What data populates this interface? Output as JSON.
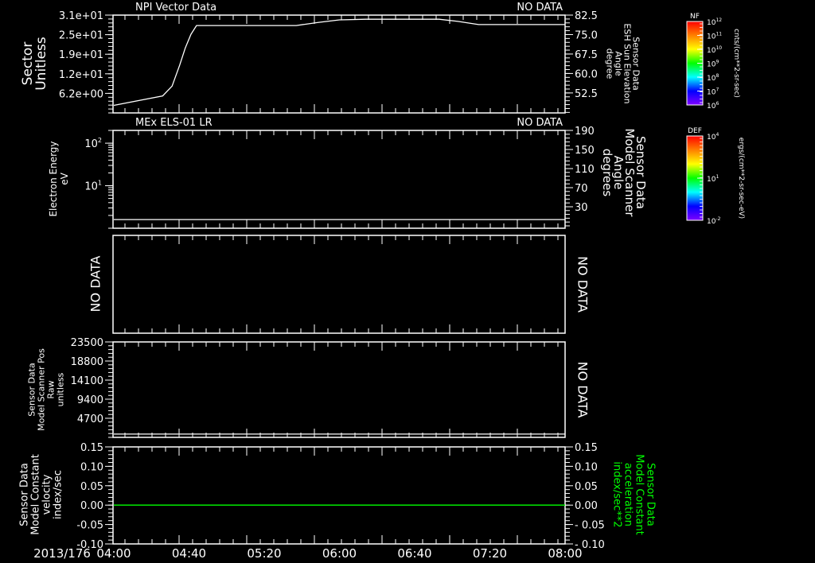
{
  "date_label": "2013/176",
  "x_ticks": [
    "04:00",
    "04:40",
    "05:20",
    "06:00",
    "06:40",
    "07:20",
    "08:00"
  ],
  "colors": {
    "background": "#000000",
    "axis": "#ffffff",
    "accent": "#00ff00"
  },
  "chart_data": [
    {
      "type": "line",
      "title": "NPI Vector Data",
      "status": "NO DATA",
      "ylabel": [
        "Sector",
        "Unitless"
      ],
      "yscale": "linear",
      "ylim": [
        0,
        31
      ],
      "yticks": [
        {
          "value": 31,
          "label": "3.1e+01"
        },
        {
          "value": 24.8,
          "label": "2.5e+01"
        },
        {
          "value": 18.6,
          "label": "1.9e+01"
        },
        {
          "value": 12.4,
          "label": "1.2e+01"
        },
        {
          "value": 6.2,
          "label": "6.2e+00"
        }
      ],
      "y2label": [
        "Sensor Data",
        "ESH Sun Elevation",
        "Angle",
        "degree"
      ],
      "y2lim": [
        44.8,
        82.5
      ],
      "y2ticks": [
        {
          "value": 82.5,
          "label": "82.5"
        },
        {
          "value": 75,
          "label": "75.0"
        },
        {
          "value": 67.5,
          "label": "67.5"
        },
        {
          "value": 60,
          "label": "60.0"
        },
        {
          "value": 52.5,
          "label": "52.5"
        }
      ],
      "series": [
        {
          "color": "#ffffff",
          "x": [
            "04:00",
            "04:26",
            "04:31",
            "04:35",
            "04:38",
            "04:41",
            "04:44",
            "05:37",
            "05:49",
            "06:00",
            "06:14",
            "06:53",
            "07:03",
            "07:14",
            "08:00"
          ],
          "y": [
            2.4,
            5.4,
            8.5,
            15.1,
            20.6,
            24.9,
            27.7,
            27.7,
            28.7,
            29.5,
            29.7,
            29.7,
            29.0,
            28.0,
            28.0
          ]
        }
      ]
    },
    {
      "type": "line",
      "title": "MEx ELS-01 LR",
      "status": "NO DATA",
      "ylabel": [
        "Electron Energy",
        "eV"
      ],
      "yscale": "log",
      "ylim": [
        1,
        200
      ],
      "yticks": [
        {
          "value": 100,
          "base": "10",
          "exp": "2"
        },
        {
          "value": 10,
          "base": "10",
          "exp": "1"
        }
      ],
      "y2label": [
        "Sensor Data",
        "Model Scanner",
        "Angle",
        "degrees"
      ],
      "y2lim": [
        -15,
        190
      ],
      "y2ticks": [
        {
          "value": 190,
          "label": "190"
        },
        {
          "value": 150,
          "label": "150"
        },
        {
          "value": 110,
          "label": "110"
        },
        {
          "value": 70,
          "label": "70"
        },
        {
          "value": 30,
          "label": "30"
        }
      ],
      "series": [
        {
          "color": "#ffffff",
          "x": [
            "04:00",
            "08:00"
          ],
          "y": [
            1.6,
            1.6
          ]
        }
      ]
    },
    {
      "type": "line",
      "no_data_left": "NO DATA",
      "no_data_right": "NO DATA"
    },
    {
      "type": "line",
      "ylabel": [
        "Sensor Data",
        "Model Scanner Pos",
        "Raw",
        "unitless"
      ],
      "yscale": "linear",
      "ylim": [
        0,
        23500
      ],
      "yticks": [
        {
          "value": 23500,
          "label": "23500"
        },
        {
          "value": 18800,
          "label": "18800"
        },
        {
          "value": 14100,
          "label": "14100"
        },
        {
          "value": 9400,
          "label": "9400"
        },
        {
          "value": 4700,
          "label": "4700"
        }
      ],
      "no_data_right": "NO DATA",
      "series": [
        {
          "color": "#ffffff",
          "x": [
            "04:00",
            "08:00"
          ],
          "y": [
            800,
            800
          ]
        }
      ]
    },
    {
      "type": "line",
      "ylabel": [
        "Sensor Data",
        "Model Constant",
        "velocity",
        "index/sec"
      ],
      "yscale": "linear",
      "ylim": [
        -0.1,
        0.15
      ],
      "yticks": [
        {
          "value": 0.15,
          "label": "0.15"
        },
        {
          "value": 0.1,
          "label": "0.10"
        },
        {
          "value": 0.05,
          "label": "0.05"
        },
        {
          "value": 0,
          "label": "0.00"
        },
        {
          "value": -0.05,
          "label": "-0.05"
        },
        {
          "value": -0.1,
          "label": "-0.10"
        }
      ],
      "y2label": [
        "Sensor Data",
        "Model Constant",
        "acceleration",
        "index/sec**2"
      ],
      "y2label_color": "#00ff00",
      "y2lim": [
        -0.1,
        0.15
      ],
      "y2ticks": [
        {
          "value": 0.15,
          "label": "0.15"
        },
        {
          "value": 0.1,
          "label": "0.10"
        },
        {
          "value": 0.05,
          "label": "0.05"
        },
        {
          "value": 0,
          "label": "0.00"
        },
        {
          "value": -0.05,
          "label": "- 0.05"
        },
        {
          "value": -0.1,
          "label": "- 0.10"
        }
      ],
      "series": [
        {
          "color": "#00ff00",
          "x": [
            "04:00",
            "08:00"
          ],
          "y": [
            0,
            0
          ]
        }
      ]
    }
  ],
  "colorbars": [
    {
      "label": "NF",
      "base": "10",
      "exps": [
        "12",
        "11",
        "10",
        "9",
        "8",
        "7",
        "6"
      ],
      "unit": "cnts/(cm**2-sr-sec)",
      "colors": [
        "#ff0000",
        "#ff8000",
        "#ffff00",
        "#00ff00",
        "#00ffff",
        "#0000ff",
        "#8000ff"
      ]
    },
    {
      "label": "DEF",
      "base": "10",
      "exps": [
        "4",
        "1",
        "-2"
      ],
      "unit": "ergs/(cm**2-sr-sec-eV)",
      "colors": [
        "#ff0000",
        "#ff8000",
        "#ffff00",
        "#00ff00",
        "#00ffff",
        "#0000ff",
        "#8000ff"
      ]
    }
  ]
}
